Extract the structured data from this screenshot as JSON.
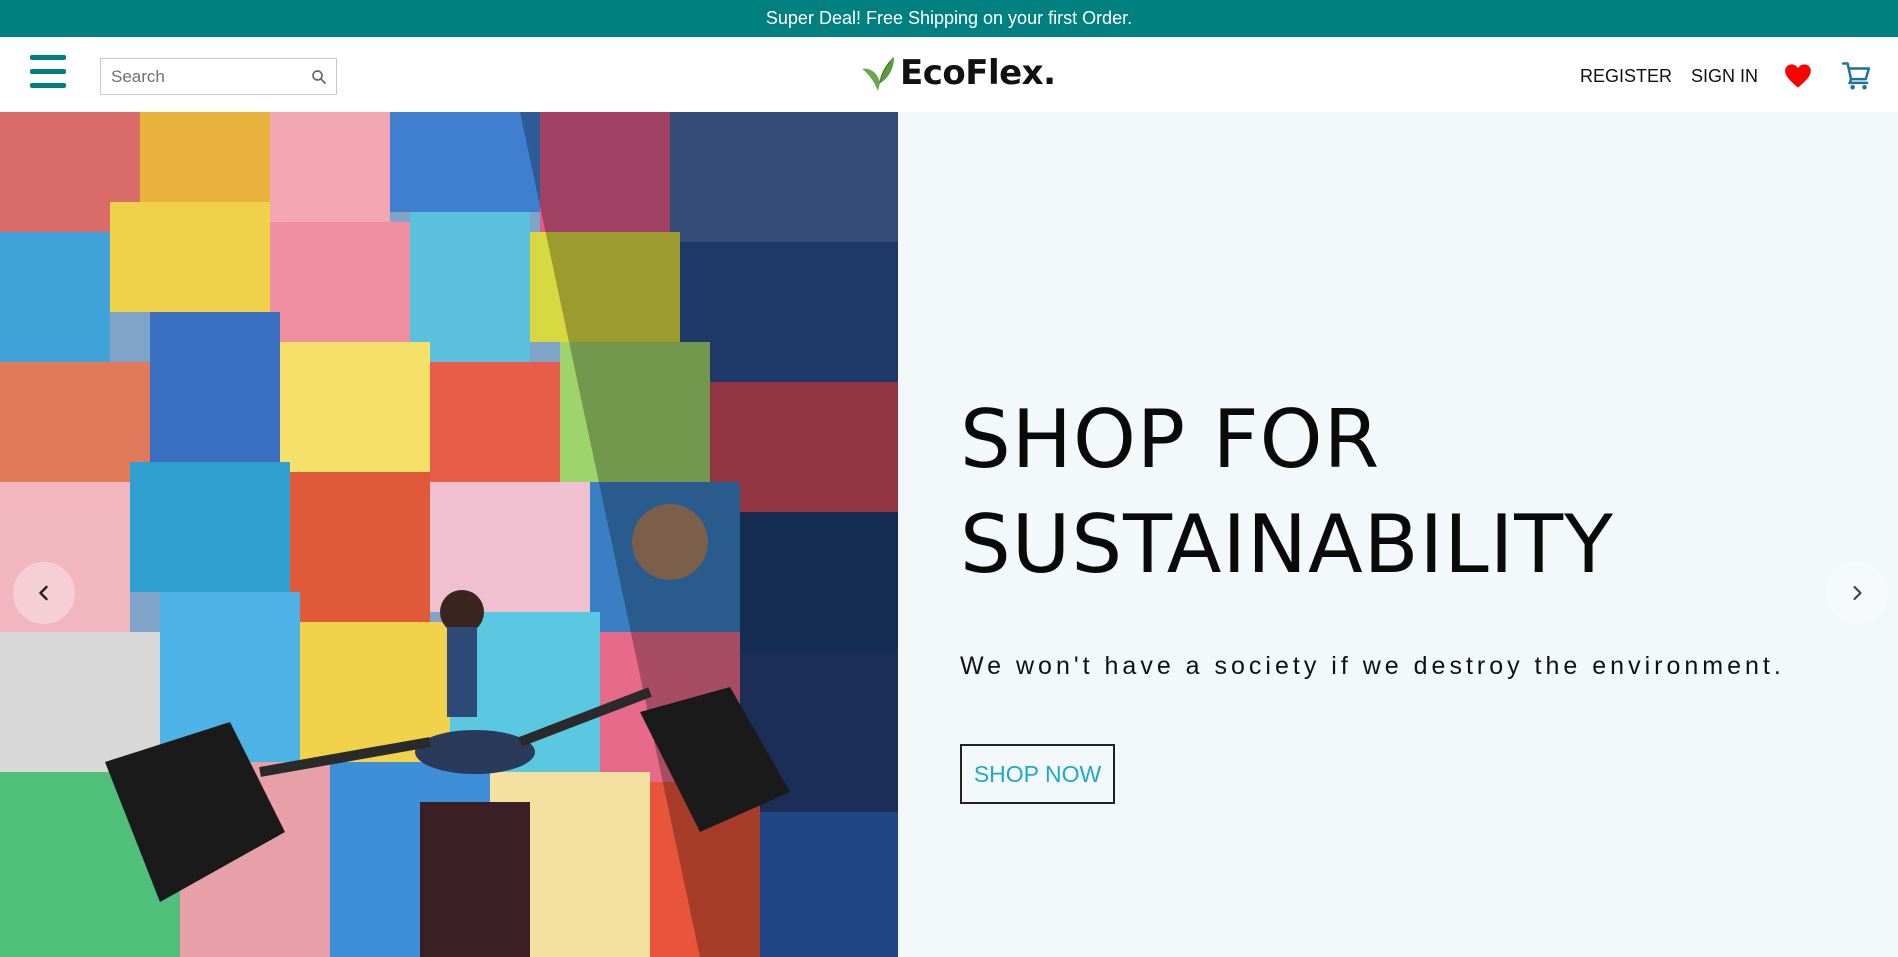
{
  "promo": {
    "text": "Super Deal! Free Shipping on your first Order."
  },
  "header": {
    "search_placeholder": "Search",
    "logo_text": "EcoFlex.",
    "register_label": "REGISTER",
    "signin_label": "SIGN IN"
  },
  "hero": {
    "title_line1": "SHOP FOR",
    "title_line2": "SUSTAINABILITY",
    "subtitle": "We won't have a society if we destroy the environment.",
    "cta_label": "SHOP NOW"
  },
  "icons": {
    "menu": "hamburger-menu-icon",
    "search": "search-icon",
    "wishlist": "heart-icon",
    "cart": "cart-icon",
    "prev": "chevron-left-icon",
    "next": "chevron-right-icon"
  },
  "colors": {
    "brand_teal": "#00807f",
    "hero_bg": "#f3f8fa",
    "cta_text": "#1fa9c7",
    "heart": "#ff0000",
    "cart": "#1f6f9f"
  }
}
